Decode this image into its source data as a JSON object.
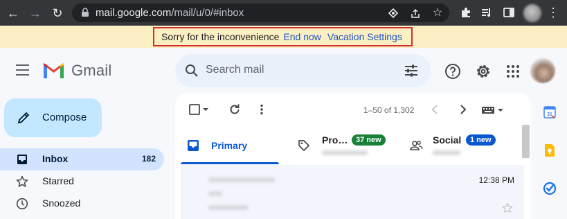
{
  "browser": {
    "url_host": "mail.google.com",
    "url_path": "/mail/u/0/#inbox"
  },
  "banner": {
    "message": "Sorry for the inconvenience",
    "end_now": "End now",
    "vacation_settings": "Vacation Settings"
  },
  "header": {
    "product": "Gmail",
    "search_placeholder": "Search mail"
  },
  "compose": {
    "label": "Compose"
  },
  "sidebar": {
    "items": [
      {
        "label": "Inbox",
        "count": "182",
        "icon": "inbox-icon",
        "active": true
      },
      {
        "label": "Starred",
        "count": "",
        "icon": "star-icon",
        "active": false
      },
      {
        "label": "Snoozed",
        "count": "",
        "icon": "clock-icon",
        "active": false
      }
    ]
  },
  "toolbar": {
    "page_info": "1–50 of 1,302"
  },
  "tabs": [
    {
      "label": "Primary",
      "badge": ""
    },
    {
      "label": "Pro…",
      "badge": "37 new",
      "badge_color": "#188038"
    },
    {
      "label": "Social",
      "badge": "1 new",
      "badge_color": "#0b57d0"
    }
  ],
  "mail": {
    "time": "12:38 PM"
  },
  "colors": {
    "accent": "#0b57d0",
    "compose_bg": "#c2e7ff",
    "active_nav": "#d3e3fd",
    "banner_bg": "#fbefc3",
    "banner_border": "#d32f2f"
  }
}
